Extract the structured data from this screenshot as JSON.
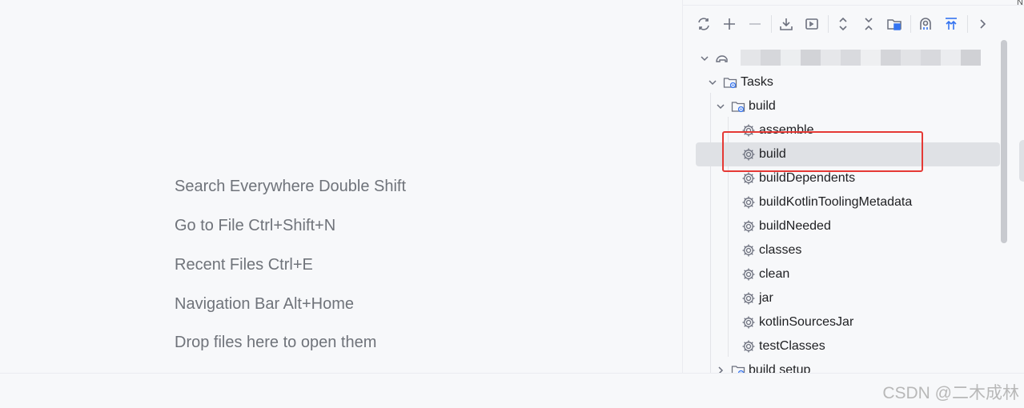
{
  "editor_hints": [
    "Search Everywhere Double Shift",
    "Go to File Ctrl+Shift+N",
    "Recent Files Ctrl+E",
    "Navigation Bar Alt+Home",
    "Drop files here to open them"
  ],
  "panel": {
    "corner_text": "N",
    "toolbar": [
      {
        "icon": "refresh-icon"
      },
      {
        "icon": "plus-icon"
      },
      {
        "icon": "minus-icon"
      },
      {
        "icon": "download-icon"
      },
      {
        "icon": "run-config-icon"
      },
      {
        "icon": "expand-all-icon"
      },
      {
        "icon": "collapse-all-icon"
      },
      {
        "icon": "open-folder-icon"
      },
      {
        "icon": "analyze-icon"
      },
      {
        "icon": "upload-icon"
      },
      {
        "icon": "chevron-right-icon"
      }
    ],
    "tree": {
      "root_label_blurred": true,
      "tasks_label": "Tasks",
      "build_group_label": "build",
      "build_tasks": [
        "assemble",
        "build",
        "buildDependents",
        "buildKotlinToolingMetadata",
        "buildNeeded",
        "classes",
        "clean",
        "jar",
        "kotlinSourcesJar",
        "testClasses"
      ],
      "next_group_label": "build setup",
      "selected_task": "build"
    },
    "highlight_color": "#e53935"
  },
  "watermark": "CSDN @二木成林"
}
